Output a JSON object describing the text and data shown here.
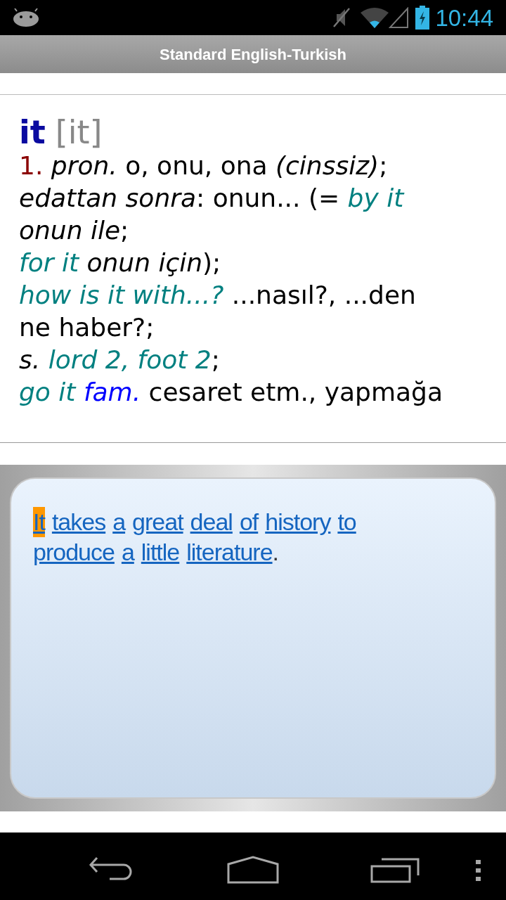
{
  "status_bar": {
    "time": "10:44"
  },
  "title_bar": {
    "title": "Standard English-Turkish"
  },
  "entry": {
    "headword": "it",
    "transcription": "[it]",
    "lines": [
      [
        {
          "kind": "number",
          "text": "1."
        },
        {
          "kind": "label",
          "text": " pron."
        },
        {
          "kind": "plain",
          "text": " o, onu, ona "
        },
        {
          "kind": "label",
          "text": "(cinssiz)"
        },
        {
          "kind": "plain",
          "text": ";"
        }
      ],
      [
        {
          "kind": "label",
          "text": "edattan sonra"
        },
        {
          "kind": "plain",
          "text": ": onun... (= "
        },
        {
          "kind": "example",
          "text": "by it"
        }
      ],
      [
        {
          "kind": "label",
          "text": "onun ile"
        },
        {
          "kind": "plain",
          "text": ";"
        }
      ],
      [
        {
          "kind": "example",
          "text": "for it"
        },
        {
          "kind": "label",
          "text": " onun için"
        },
        {
          "kind": "plain",
          "text": ");"
        }
      ],
      [
        {
          "kind": "example",
          "text": "how is it with...?"
        },
        {
          "kind": "plain",
          "text": " ...nasıl?, ...den"
        }
      ],
      [
        {
          "kind": "plain",
          "text": "ne haber?;"
        }
      ],
      [
        {
          "kind": "label",
          "text": "s."
        },
        {
          "kind": "example",
          "text": " lord 2, foot 2"
        },
        {
          "kind": "plain",
          "text": ";"
        }
      ],
      [
        {
          "kind": "example",
          "text": "go it"
        },
        {
          "kind": "abbr",
          "text": " fam."
        },
        {
          "kind": "plain",
          "text": " cesaret etm., yapmağa"
        }
      ]
    ]
  },
  "sentence": {
    "lines": [
      [
        {
          "kind": "word",
          "text": "It",
          "selected": true
        },
        {
          "kind": "word",
          "text": "takes",
          "selected": false
        },
        {
          "kind": "word",
          "text": "a",
          "selected": false
        },
        {
          "kind": "word",
          "text": "great",
          "selected": false
        },
        {
          "kind": "word",
          "text": "deal",
          "selected": false
        },
        {
          "kind": "word",
          "text": "of",
          "selected": false
        },
        {
          "kind": "word",
          "text": "history",
          "selected": false
        },
        {
          "kind": "word",
          "text": "to",
          "selected": false
        }
      ],
      [
        {
          "kind": "word",
          "text": "produce",
          "selected": false
        },
        {
          "kind": "word",
          "text": "a",
          "selected": false
        },
        {
          "kind": "word",
          "text": "little",
          "selected": false
        },
        {
          "kind": "word",
          "text": "literature",
          "selected": false
        },
        {
          "kind": "punct",
          "text": "."
        }
      ]
    ]
  }
}
